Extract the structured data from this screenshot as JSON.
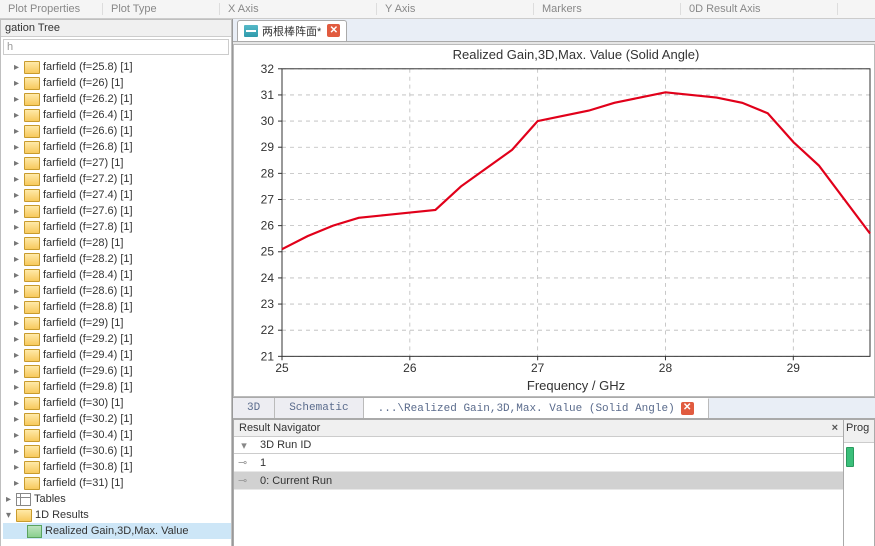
{
  "ribbon": {
    "items": [
      "Plot Properties",
      "Plot Type",
      "X Axis",
      "Y Axis",
      "Markers",
      "0D Result Axis"
    ]
  },
  "left": {
    "title": "gation Tree",
    "search_placeholder": "h",
    "farfield_items": [
      "farfield (f=25.8) [1]",
      "farfield (f=26) [1]",
      "farfield (f=26.2) [1]",
      "farfield (f=26.4) [1]",
      "farfield (f=26.6) [1]",
      "farfield (f=26.8) [1]",
      "farfield (f=27) [1]",
      "farfield (f=27.2) [1]",
      "farfield (f=27.4) [1]",
      "farfield (f=27.6) [1]",
      "farfield (f=27.8) [1]",
      "farfield (f=28) [1]",
      "farfield (f=28.2) [1]",
      "farfield (f=28.4) [1]",
      "farfield (f=28.6) [1]",
      "farfield (f=28.8) [1]",
      "farfield (f=29) [1]",
      "farfield (f=29.2) [1]",
      "farfield (f=29.4) [1]",
      "farfield (f=29.6) [1]",
      "farfield (f=29.8) [1]",
      "farfield (f=30) [1]",
      "farfield (f=30.2) [1]",
      "farfield (f=30.4) [1]",
      "farfield (f=30.6) [1]",
      "farfield (f=30.8) [1]",
      "farfield (f=31) [1]"
    ],
    "tables_label": "Tables",
    "results_1d_label": "1D Results",
    "selected_result": "Realized Gain,3D,Max. Value "
  },
  "top_tab": {
    "label": "两根棒阵面*"
  },
  "bottom_tabs": {
    "t3d": "3D",
    "tsch": "Schematic",
    "tres": "...\\Realized Gain,3D,Max. Value (Solid Angle)"
  },
  "result_nav": {
    "title": "Result Navigator",
    "col": "3D Run ID",
    "rows": [
      "1",
      "0: Current Run"
    ],
    "right_title": "Prog"
  },
  "chart_data": {
    "type": "line",
    "title": "Realized Gain,3D,Max. Value (Solid Angle)",
    "xlabel": "Frequency / GHz",
    "ylabel": "",
    "xlim": [
      25,
      29.6
    ],
    "ylim": [
      21,
      32
    ],
    "xticks": [
      25,
      26,
      27,
      28,
      29
    ],
    "yticks": [
      21,
      22,
      23,
      24,
      25,
      26,
      27,
      28,
      29,
      30,
      31,
      32
    ],
    "series": [
      {
        "name": "Realized Gain",
        "color": "#e1001a",
        "x": [
          25.0,
          25.2,
          25.4,
          25.6,
          25.8,
          26.0,
          26.2,
          26.4,
          26.6,
          26.8,
          27.0,
          27.2,
          27.4,
          27.6,
          27.8,
          28.0,
          28.2,
          28.4,
          28.6,
          28.8,
          29.0,
          29.2,
          29.4,
          29.6
        ],
        "values": [
          25.1,
          25.6,
          26.0,
          26.3,
          26.4,
          26.5,
          26.6,
          27.5,
          28.2,
          28.9,
          30.0,
          30.2,
          30.4,
          30.7,
          30.9,
          31.1,
          31.0,
          30.9,
          30.7,
          30.3,
          29.2,
          28.3,
          27.0,
          25.7
        ]
      }
    ]
  }
}
